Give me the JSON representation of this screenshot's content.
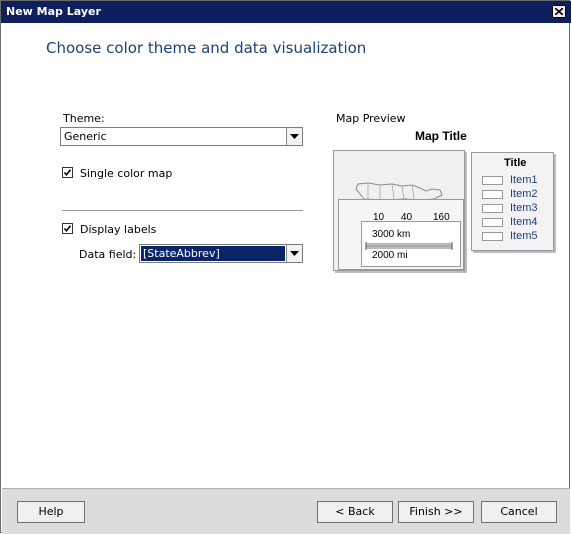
{
  "window": {
    "title": "New Map Layer"
  },
  "page": {
    "heading": "Choose color theme and data visualization"
  },
  "theme": {
    "label": "Theme:",
    "value": "Generic"
  },
  "single_color": {
    "label": "Single color map",
    "checked": true
  },
  "display_labels": {
    "label": "Display labels",
    "checked": true
  },
  "data_field": {
    "label": "Data field:",
    "value": "[StateAbbrev]"
  },
  "preview": {
    "label": "Map Preview",
    "map_title": "Map Title",
    "scale_values": [
      "10",
      "40",
      "160"
    ],
    "distance_km": "3000 km",
    "distance_mi": "2000 mi",
    "legend": {
      "title": "Title",
      "items": [
        "Item1",
        "Item2",
        "Item3",
        "Item4",
        "Item5"
      ]
    }
  },
  "footer": {
    "help_label": "Help",
    "back_label": "< Back",
    "finish_label": "Finish >>",
    "cancel_label": "Cancel"
  }
}
